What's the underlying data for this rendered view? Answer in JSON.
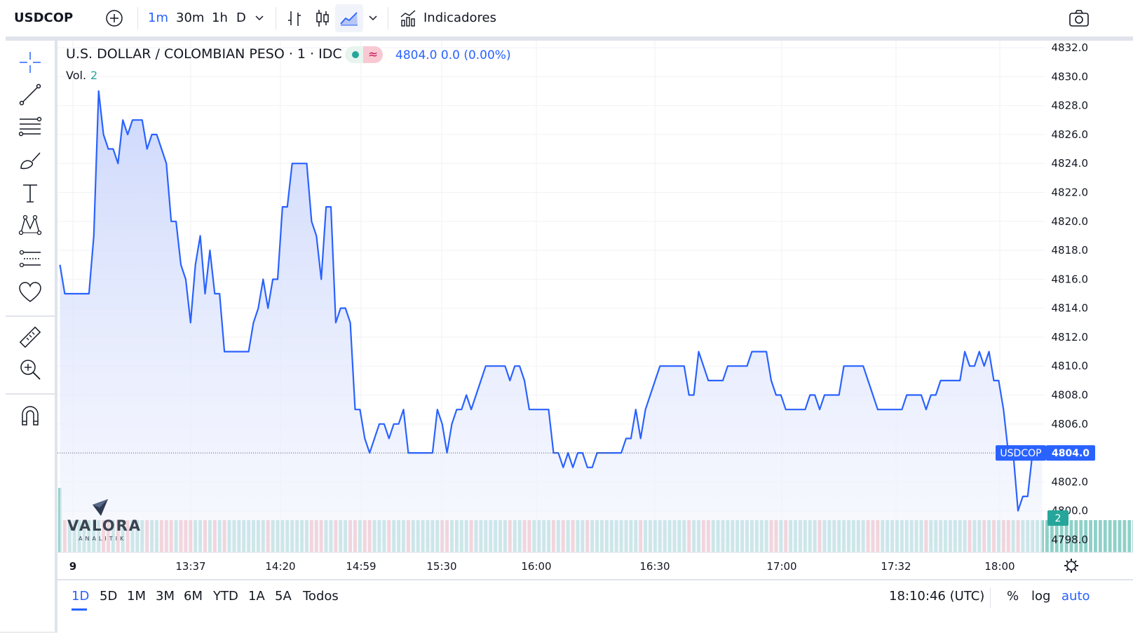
{
  "topbar": {
    "symbol": "USDCOP",
    "intervals": [
      "1m",
      "30m",
      "1h",
      "D"
    ],
    "active_interval": "1m",
    "indicators_label": "Indicadores"
  },
  "legend": {
    "title": "U.S. DOLLAR / COLOMBIAN PESO · 1 · IDC",
    "price_text": "4804.0  0.0 (0.00%)",
    "vol_label": "Vol.",
    "vol_value": "2",
    "wave_symbol": "≈"
  },
  "bottom": {
    "ranges": [
      "1D",
      "5D",
      "1M",
      "3M",
      "6M",
      "YTD",
      "1A",
      "5A",
      "Todos"
    ],
    "active_range": "1D",
    "clock": "18:10:46 (UTC)",
    "pct_label": "%",
    "log_label": "log",
    "auto_label": "auto"
  },
  "logo": {
    "word": "VALORA",
    "sub": "ANALITIK"
  },
  "colors": {
    "line": "#2962ff",
    "area_top": "#c7d3fb",
    "area_bottom": "#f4f6fe",
    "vol_up": "#8fd0c8",
    "vol_down": "#f0a3a6",
    "price_label": "#2962ff",
    "vol_label_bg": "#26a69a"
  },
  "chart_data": {
    "type": "line",
    "series": [
      {
        "name": "USDCOP",
        "values": [
          4817,
          4815,
          4815,
          4815,
          4815,
          4815,
          4815,
          4819,
          4829,
          4826,
          4825,
          4825,
          4824,
          4827,
          4826,
          4827,
          4827,
          4827,
          4825,
          4826,
          4826,
          4825,
          4824,
          4820,
          4820,
          4817,
          4816,
          4813,
          4817,
          4819,
          4815,
          4818,
          4815,
          4815,
          4811,
          4811,
          4811,
          4811,
          4811,
          4811,
          4813,
          4814,
          4816,
          4814,
          4816,
          4816,
          4821,
          4821,
          4824,
          4824,
          4824,
          4824,
          4820,
          4819,
          4816,
          4821,
          4821,
          4813,
          4814,
          4814,
          4813,
          4807,
          4807,
          4805,
          4804,
          4805,
          4806,
          4806,
          4805,
          4806,
          4806,
          4807,
          4804,
          4804,
          4804,
          4804,
          4804,
          4804,
          4807,
          4806,
          4804,
          4806,
          4807,
          4807,
          4808,
          4807,
          4808,
          4809,
          4810,
          4810,
          4810,
          4810,
          4810,
          4809,
          4810,
          4810,
          4809,
          4807,
          4807,
          4807,
          4807,
          4807,
          4804,
          4804,
          4803,
          4804,
          4803,
          4804,
          4804,
          4803,
          4803,
          4804,
          4804,
          4804,
          4804,
          4804,
          4804,
          4805,
          4805,
          4807,
          4805,
          4807,
          4808,
          4809,
          4810,
          4810,
          4810,
          4810,
          4810,
          4810,
          4808,
          4808,
          4811,
          4810,
          4809,
          4809,
          4809,
          4809,
          4810,
          4810,
          4810,
          4810,
          4810,
          4811,
          4811,
          4811,
          4811,
          4809,
          4808,
          4808,
          4807,
          4807,
          4807,
          4807,
          4807,
          4808,
          4808,
          4807,
          4808,
          4808,
          4808,
          4808,
          4810,
          4810,
          4810,
          4810,
          4810,
          4809,
          4808,
          4807,
          4807,
          4807,
          4807,
          4807,
          4807,
          4808,
          4808,
          4808,
          4808,
          4807,
          4808,
          4808,
          4809,
          4809,
          4809,
          4809,
          4809,
          4811,
          4810,
          4810,
          4811,
          4810,
          4811,
          4809,
          4809,
          4807,
          4804,
          4804,
          4800,
          4801,
          4801,
          4804,
          4804,
          4804
        ],
        "volume": [
          2,
          1,
          1,
          1,
          1,
          1,
          1,
          1,
          1,
          1,
          1,
          1,
          1,
          1,
          1,
          1,
          1,
          1,
          1,
          1,
          1,
          1,
          1,
          1,
          1,
          1,
          1,
          1,
          1,
          1,
          1,
          1,
          1,
          1,
          1,
          1,
          1,
          1,
          1,
          1,
          1,
          1,
          1,
          1,
          1,
          1,
          1,
          1,
          1,
          1,
          1,
          1,
          1,
          1,
          1,
          1,
          1,
          1,
          1,
          1,
          1,
          1,
          1,
          1,
          1,
          1,
          1,
          1,
          1,
          1,
          1,
          1,
          1,
          1,
          1,
          1,
          1,
          1,
          1,
          1,
          1,
          1,
          1,
          1,
          1,
          1,
          1,
          1,
          1,
          1,
          1,
          1,
          1,
          1,
          1,
          1,
          1,
          1,
          1,
          1,
          1,
          1,
          1,
          1,
          1,
          1,
          1,
          1,
          1,
          1,
          1,
          1,
          1,
          1,
          1,
          1,
          1,
          1,
          1,
          1,
          1,
          1,
          1,
          1,
          1,
          1,
          1,
          1,
          1,
          1,
          1,
          1,
          1,
          1,
          1,
          1,
          1,
          1,
          1,
          1,
          1,
          1,
          1,
          1,
          1,
          1,
          1,
          1,
          1,
          1,
          1,
          1,
          1,
          1,
          1,
          1,
          1,
          1,
          1,
          1,
          1,
          1,
          1,
          1,
          1,
          1,
          1,
          1,
          1,
          1,
          1,
          1,
          1,
          1,
          1,
          1,
          1,
          1,
          1,
          1,
          1,
          1,
          1,
          1,
          1,
          1,
          1,
          1,
          1,
          1,
          1,
          1,
          1,
          1,
          1,
          1,
          1,
          1,
          1,
          1,
          1,
          1,
          1,
          1,
          1,
          1,
          1,
          1,
          1,
          1,
          1,
          1,
          1,
          1,
          1,
          1,
          1,
          1,
          1,
          1,
          1,
          1,
          1,
          1,
          1,
          1,
          1,
          1,
          1,
          1,
          1,
          1,
          1,
          1,
          1,
          1,
          1,
          1,
          1,
          1,
          1,
          1,
          1,
          1,
          1,
          1,
          1,
          1,
          1,
          1,
          1,
          1,
          1,
          1,
          1,
          1,
          1,
          1,
          1,
          1,
          1,
          1,
          1,
          1,
          1,
          1,
          1,
          1,
          1,
          1,
          1,
          1,
          1,
          1,
          1,
          1,
          1,
          1,
          1,
          1,
          1,
          1,
          1,
          1,
          1,
          1,
          1,
          1,
          1,
          1,
          1,
          1,
          1,
          1,
          1,
          1,
          1,
          1,
          1,
          1,
          1,
          1,
          1,
          1,
          1,
          1,
          1,
          1,
          1,
          1,
          1,
          1,
          1
        ]
      }
    ],
    "x_ticks": [
      "9",
      "13:37",
      "14:20",
      "14:59",
      "15:30",
      "16:00",
      "16:30",
      "17:00",
      "17:32",
      "18:00"
    ],
    "y_ticks": [
      "4832.0",
      "4830.0",
      "4828.0",
      "4826.0",
      "4824.0",
      "4822.0",
      "4820.0",
      "4818.0",
      "4816.0",
      "4814.0",
      "4812.0",
      "4810.0",
      "4808.0",
      "4806.0",
      "4804.0",
      "4802.0",
      "4800.0",
      "4798.0"
    ],
    "ylim": [
      4797.5,
      4832.5
    ],
    "last_price_label": "4804.0",
    "last_symbol_label": "USDCOP",
    "last_volume_label": "2",
    "grid": true
  }
}
